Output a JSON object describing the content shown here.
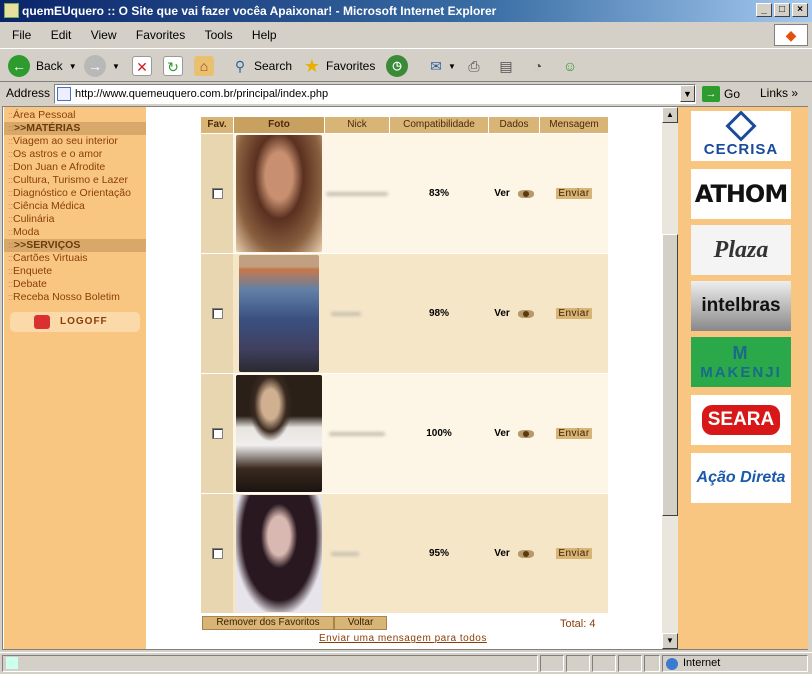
{
  "window": {
    "title": "quemEUquero :: O Site que vai fazer vocêa Apaixonar! - Microsoft Internet Explorer"
  },
  "menu": [
    "File",
    "Edit",
    "View",
    "Favorites",
    "Tools",
    "Help"
  ],
  "toolbar": {
    "back": "Back",
    "search": "Search",
    "favorites": "Favorites"
  },
  "address": {
    "label": "Address",
    "url": "http://www.quemeuquero.com.br/principal/index.php",
    "go": "Go",
    "links": "Links"
  },
  "leftnav": {
    "items": [
      {
        "label": "Área Pessoal",
        "head": false
      },
      {
        "label": ">>MATÉRIAS",
        "head": true
      },
      {
        "label": "Viagem ao seu interior",
        "head": false
      },
      {
        "label": "Os astros e o amor",
        "head": false
      },
      {
        "label": "Don Juan e Afrodite",
        "head": false
      },
      {
        "label": "Cultura, Turismo e Lazer",
        "head": false
      },
      {
        "label": "Diagnóstico e Orientação",
        "head": false
      },
      {
        "label": "Ciência Médica",
        "head": false
      },
      {
        "label": "Culinária",
        "head": false
      },
      {
        "label": "Moda",
        "head": false
      },
      {
        "label": ">>SERVIÇOS",
        "head": true
      },
      {
        "label": "Cartões Virtuais",
        "head": false
      },
      {
        "label": "Enquete",
        "head": false
      },
      {
        "label": "Debate",
        "head": false
      },
      {
        "label": "Receba Nosso Boletim",
        "head": false
      }
    ],
    "logoff": "LOGOFF"
  },
  "table": {
    "headers": {
      "fav": "Fav.",
      "foto": "Foto",
      "nick": "Nick",
      "compat": "Compatibilidade",
      "dados": "Dados",
      "msg": "Mensagem"
    },
    "rows": [
      {
        "compat": "83%",
        "ver": "Ver",
        "enviar": "Enviar",
        "bg": "#fdf6e6",
        "photo": "#6a4030"
      },
      {
        "compat": "98%",
        "ver": "Ver",
        "enviar": "Enviar",
        "bg": "#f5e6c8",
        "photo": "#3a4a6a"
      },
      {
        "compat": "100%",
        "ver": "Ver",
        "enviar": "Enviar",
        "bg": "#fdf6e6",
        "photo": "#3a2a20"
      },
      {
        "compat": "95%",
        "ver": "Ver",
        "enviar": "Enviar",
        "bg": "#f5e6c8",
        "photo": "#2a1a20"
      }
    ]
  },
  "footer": {
    "remove": "Remover dos Favoritos",
    "back": "Voltar",
    "total": "Total: 4",
    "sendall": "Enviar uma mensagem para todos"
  },
  "sponsors": [
    "CECRISA",
    "ATHOM",
    "Plaza",
    "intelbras",
    "MAKENJI",
    "SEARA",
    "Ação Direta"
  ],
  "status": {
    "zone": "Internet"
  }
}
